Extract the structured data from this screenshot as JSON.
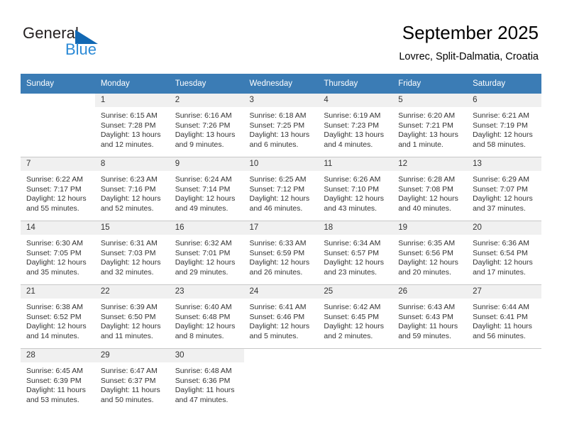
{
  "brand": {
    "name_part1": "General",
    "name_part2": "Blue",
    "triangle_color": "#1268b3",
    "blue_text_color": "#2b8ad6"
  },
  "header": {
    "title": "September 2025",
    "subtitle": "Lovrec, Split-Dalmatia, Croatia"
  },
  "theme": {
    "header_row_bg": "#3b7cb5",
    "header_row_text": "#ffffff",
    "daynum_band_bg": "#f0f0f0",
    "cell_text": "#333333",
    "grid_line": "#c8c8c8"
  },
  "weekdays": [
    "Sunday",
    "Monday",
    "Tuesday",
    "Wednesday",
    "Thursday",
    "Friday",
    "Saturday"
  ],
  "labels": {
    "sunrise_prefix": "Sunrise:",
    "sunset_prefix": "Sunset:",
    "daylight_prefix": "Daylight:"
  },
  "weeks": [
    [
      {
        "day": "",
        "empty": true,
        "sunrise": "",
        "sunset": "",
        "daylight_line1": "",
        "daylight_line2": ""
      },
      {
        "day": "1",
        "sunrise": "Sunrise: 6:15 AM",
        "sunset": "Sunset: 7:28 PM",
        "daylight_line1": "Daylight: 13 hours",
        "daylight_line2": "and 12 minutes."
      },
      {
        "day": "2",
        "sunrise": "Sunrise: 6:16 AM",
        "sunset": "Sunset: 7:26 PM",
        "daylight_line1": "Daylight: 13 hours",
        "daylight_line2": "and 9 minutes."
      },
      {
        "day": "3",
        "sunrise": "Sunrise: 6:18 AM",
        "sunset": "Sunset: 7:25 PM",
        "daylight_line1": "Daylight: 13 hours",
        "daylight_line2": "and 6 minutes."
      },
      {
        "day": "4",
        "sunrise": "Sunrise: 6:19 AM",
        "sunset": "Sunset: 7:23 PM",
        "daylight_line1": "Daylight: 13 hours",
        "daylight_line2": "and 4 minutes."
      },
      {
        "day": "5",
        "sunrise": "Sunrise: 6:20 AM",
        "sunset": "Sunset: 7:21 PM",
        "daylight_line1": "Daylight: 13 hours",
        "daylight_line2": "and 1 minute."
      },
      {
        "day": "6",
        "sunrise": "Sunrise: 6:21 AM",
        "sunset": "Sunset: 7:19 PM",
        "daylight_line1": "Daylight: 12 hours",
        "daylight_line2": "and 58 minutes."
      }
    ],
    [
      {
        "day": "7",
        "sunrise": "Sunrise: 6:22 AM",
        "sunset": "Sunset: 7:17 PM",
        "daylight_line1": "Daylight: 12 hours",
        "daylight_line2": "and 55 minutes."
      },
      {
        "day": "8",
        "sunrise": "Sunrise: 6:23 AM",
        "sunset": "Sunset: 7:16 PM",
        "daylight_line1": "Daylight: 12 hours",
        "daylight_line2": "and 52 minutes."
      },
      {
        "day": "9",
        "sunrise": "Sunrise: 6:24 AM",
        "sunset": "Sunset: 7:14 PM",
        "daylight_line1": "Daylight: 12 hours",
        "daylight_line2": "and 49 minutes."
      },
      {
        "day": "10",
        "sunrise": "Sunrise: 6:25 AM",
        "sunset": "Sunset: 7:12 PM",
        "daylight_line1": "Daylight: 12 hours",
        "daylight_line2": "and 46 minutes."
      },
      {
        "day": "11",
        "sunrise": "Sunrise: 6:26 AM",
        "sunset": "Sunset: 7:10 PM",
        "daylight_line1": "Daylight: 12 hours",
        "daylight_line2": "and 43 minutes."
      },
      {
        "day": "12",
        "sunrise": "Sunrise: 6:28 AM",
        "sunset": "Sunset: 7:08 PM",
        "daylight_line1": "Daylight: 12 hours",
        "daylight_line2": "and 40 minutes."
      },
      {
        "day": "13",
        "sunrise": "Sunrise: 6:29 AM",
        "sunset": "Sunset: 7:07 PM",
        "daylight_line1": "Daylight: 12 hours",
        "daylight_line2": "and 37 minutes."
      }
    ],
    [
      {
        "day": "14",
        "sunrise": "Sunrise: 6:30 AM",
        "sunset": "Sunset: 7:05 PM",
        "daylight_line1": "Daylight: 12 hours",
        "daylight_line2": "and 35 minutes."
      },
      {
        "day": "15",
        "sunrise": "Sunrise: 6:31 AM",
        "sunset": "Sunset: 7:03 PM",
        "daylight_line1": "Daylight: 12 hours",
        "daylight_line2": "and 32 minutes."
      },
      {
        "day": "16",
        "sunrise": "Sunrise: 6:32 AM",
        "sunset": "Sunset: 7:01 PM",
        "daylight_line1": "Daylight: 12 hours",
        "daylight_line2": "and 29 minutes."
      },
      {
        "day": "17",
        "sunrise": "Sunrise: 6:33 AM",
        "sunset": "Sunset: 6:59 PM",
        "daylight_line1": "Daylight: 12 hours",
        "daylight_line2": "and 26 minutes."
      },
      {
        "day": "18",
        "sunrise": "Sunrise: 6:34 AM",
        "sunset": "Sunset: 6:57 PM",
        "daylight_line1": "Daylight: 12 hours",
        "daylight_line2": "and 23 minutes."
      },
      {
        "day": "19",
        "sunrise": "Sunrise: 6:35 AM",
        "sunset": "Sunset: 6:56 PM",
        "daylight_line1": "Daylight: 12 hours",
        "daylight_line2": "and 20 minutes."
      },
      {
        "day": "20",
        "sunrise": "Sunrise: 6:36 AM",
        "sunset": "Sunset: 6:54 PM",
        "daylight_line1": "Daylight: 12 hours",
        "daylight_line2": "and 17 minutes."
      }
    ],
    [
      {
        "day": "21",
        "sunrise": "Sunrise: 6:38 AM",
        "sunset": "Sunset: 6:52 PM",
        "daylight_line1": "Daylight: 12 hours",
        "daylight_line2": "and 14 minutes."
      },
      {
        "day": "22",
        "sunrise": "Sunrise: 6:39 AM",
        "sunset": "Sunset: 6:50 PM",
        "daylight_line1": "Daylight: 12 hours",
        "daylight_line2": "and 11 minutes."
      },
      {
        "day": "23",
        "sunrise": "Sunrise: 6:40 AM",
        "sunset": "Sunset: 6:48 PM",
        "daylight_line1": "Daylight: 12 hours",
        "daylight_line2": "and 8 minutes."
      },
      {
        "day": "24",
        "sunrise": "Sunrise: 6:41 AM",
        "sunset": "Sunset: 6:46 PM",
        "daylight_line1": "Daylight: 12 hours",
        "daylight_line2": "and 5 minutes."
      },
      {
        "day": "25",
        "sunrise": "Sunrise: 6:42 AM",
        "sunset": "Sunset: 6:45 PM",
        "daylight_line1": "Daylight: 12 hours",
        "daylight_line2": "and 2 minutes."
      },
      {
        "day": "26",
        "sunrise": "Sunrise: 6:43 AM",
        "sunset": "Sunset: 6:43 PM",
        "daylight_line1": "Daylight: 11 hours",
        "daylight_line2": "and 59 minutes."
      },
      {
        "day": "27",
        "sunrise": "Sunrise: 6:44 AM",
        "sunset": "Sunset: 6:41 PM",
        "daylight_line1": "Daylight: 11 hours",
        "daylight_line2": "and 56 minutes."
      }
    ],
    [
      {
        "day": "28",
        "sunrise": "Sunrise: 6:45 AM",
        "sunset": "Sunset: 6:39 PM",
        "daylight_line1": "Daylight: 11 hours",
        "daylight_line2": "and 53 minutes."
      },
      {
        "day": "29",
        "sunrise": "Sunrise: 6:47 AM",
        "sunset": "Sunset: 6:37 PM",
        "daylight_line1": "Daylight: 11 hours",
        "daylight_line2": "and 50 minutes."
      },
      {
        "day": "30",
        "sunrise": "Sunrise: 6:48 AM",
        "sunset": "Sunset: 6:36 PM",
        "daylight_line1": "Daylight: 11 hours",
        "daylight_line2": "and 47 minutes."
      },
      {
        "day": "",
        "empty": true,
        "sunrise": "",
        "sunset": "",
        "daylight_line1": "",
        "daylight_line2": ""
      },
      {
        "day": "",
        "empty": true,
        "sunrise": "",
        "sunset": "",
        "daylight_line1": "",
        "daylight_line2": ""
      },
      {
        "day": "",
        "empty": true,
        "sunrise": "",
        "sunset": "",
        "daylight_line1": "",
        "daylight_line2": ""
      },
      {
        "day": "",
        "empty": true,
        "sunrise": "",
        "sunset": "",
        "daylight_line1": "",
        "daylight_line2": ""
      }
    ]
  ]
}
